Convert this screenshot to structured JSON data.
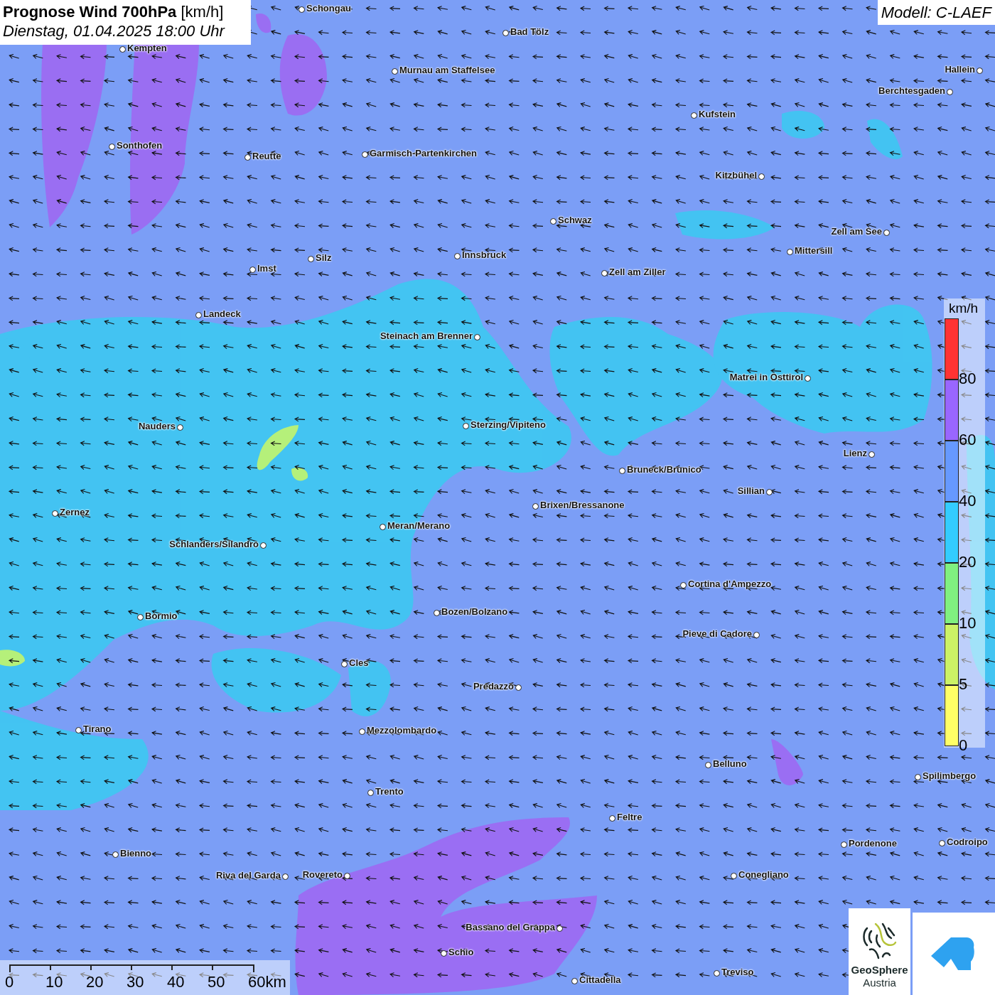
{
  "header": {
    "title": "Prognose Wind 700hPa",
    "unit": "[km/h]",
    "datetime": "Dienstag, 01.04.2025 18:00 Uhr"
  },
  "model": "Modell: C-LAEF",
  "cities": [
    {
      "name": "Schongau"
    },
    {
      "name": "Bad Tölz"
    },
    {
      "name": "Kempten"
    },
    {
      "name": "Murnau am Staffelsee"
    },
    {
      "name": "Hallein"
    },
    {
      "name": "Berchtesgaden"
    },
    {
      "name": "Kufstein"
    },
    {
      "name": "Sonthofen"
    },
    {
      "name": "Reutte"
    },
    {
      "name": "Garmisch-Partenkirchen"
    },
    {
      "name": "Kitzbühel"
    },
    {
      "name": "Schwaz"
    },
    {
      "name": "Zell am See"
    },
    {
      "name": "Mittersill"
    },
    {
      "name": "Innsbruck"
    },
    {
      "name": "Silz"
    },
    {
      "name": "Imst"
    },
    {
      "name": "Zell am Ziller"
    },
    {
      "name": "Landeck"
    },
    {
      "name": "Steinach am Brenner"
    },
    {
      "name": "Matrei in Osttirol"
    },
    {
      "name": "Nauders"
    },
    {
      "name": "Sterzing/Vipiteno"
    },
    {
      "name": "Lienz"
    },
    {
      "name": "Bruneck/Brunico"
    },
    {
      "name": "Sillian"
    },
    {
      "name": "Brixen/Bressanone"
    },
    {
      "name": "Zernez"
    },
    {
      "name": "Meran/Merano"
    },
    {
      "name": "Schlanders/Silandro"
    },
    {
      "name": "Cortina d'Ampezzo"
    },
    {
      "name": "Bozen/Bolzano"
    },
    {
      "name": "Bormio"
    },
    {
      "name": "Pieve di Cadore"
    },
    {
      "name": "Cles"
    },
    {
      "name": "Predazzo"
    },
    {
      "name": "Tirano"
    },
    {
      "name": "Mezzolombardo"
    },
    {
      "name": "Belluno"
    },
    {
      "name": "Spilimbergo"
    },
    {
      "name": "Trento"
    },
    {
      "name": "Feltre"
    },
    {
      "name": "Pordenone"
    },
    {
      "name": "Codroipo"
    },
    {
      "name": "Bienno"
    },
    {
      "name": "Riva del Garda"
    },
    {
      "name": "Rovereto"
    },
    {
      "name": "Conegliano"
    },
    {
      "name": "Bassano del Grappa"
    },
    {
      "name": "Schio"
    },
    {
      "name": "Treviso"
    },
    {
      "name": "Cittadella"
    }
  ],
  "legend": {
    "unit": "km/h",
    "bands": [
      {
        "label": "80",
        "color": "#ff3333"
      },
      {
        "label": "60",
        "color": "#9966ff"
      },
      {
        "label": "40",
        "color": "#6699ff"
      },
      {
        "label": "20",
        "color": "#33ccff"
      },
      {
        "label": "10",
        "color": "#80f080"
      },
      {
        "label": "5",
        "color": "#ccf266"
      },
      {
        "label": "0",
        "color": "#ffff66"
      }
    ]
  },
  "scale_bar": [
    "0",
    "10",
    "20",
    "30",
    "40",
    "50",
    "60km"
  ],
  "logos": {
    "geosphere": [
      "GeoSphere",
      "Austria"
    ]
  }
}
